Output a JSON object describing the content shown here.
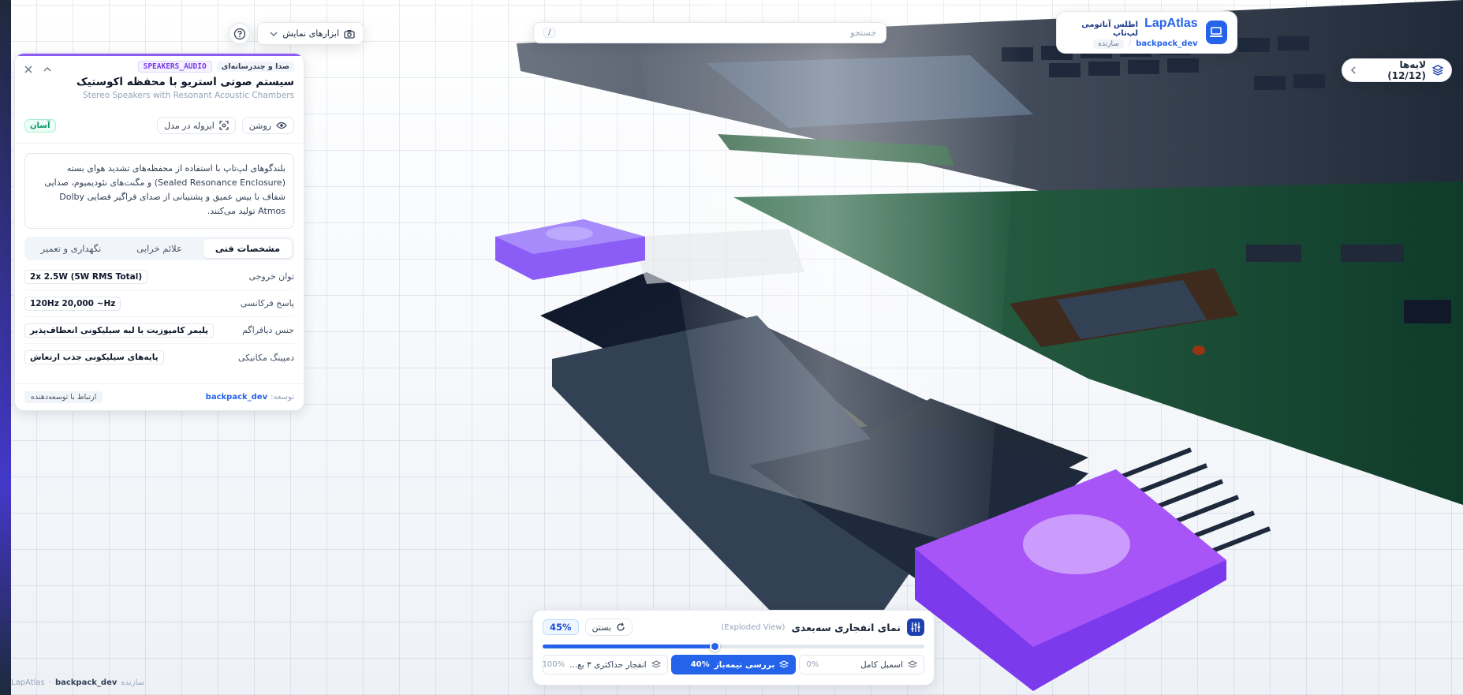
{
  "brand": {
    "name_a": "Lap",
    "name_b": "Atlas",
    "subtitle": "اطلس آناتومی لپ‌تاپ",
    "developer": "backpack_dev",
    "role": "سازنده"
  },
  "layers": {
    "label": "لایه‌ها (12/12)"
  },
  "search": {
    "placeholder": "جستجو",
    "shortcut": "/"
  },
  "toolbar": {
    "view_tools_label": "ابزارهای نمایش"
  },
  "detail": {
    "category_tag": "صدا و چندرسانه‌ای",
    "code_tag": "SPEAKERS_AUDIO",
    "title": "سیستم صوتی استریو با محفظه اکوستیک",
    "title_en": "Stereo Speakers with Resonant Acoustic Chambers",
    "actions": {
      "light_label": "روشن",
      "isolate_label": "ایزوله در مدل"
    },
    "difficulty": "آسان",
    "description": "بلندگوهای لپ‌تاپ با استفاده از محفظه‌های تشدید هوای بسته (Sealed Resonance Enclosure) و مگنت‌های نئودیمیوم، صدایی شفاف با بیس عمیق و پشتیبانی از صدای فراگیر فضایی Dolby Atmos تولید می‌کنند.",
    "tabs": [
      "مشخصات فنی",
      "علائم خرابی",
      "نگهداری و تعمیر"
    ],
    "specs": [
      {
        "label": "توان خروجی",
        "value": "2x 2.5W (5W RMS Total)"
      },
      {
        "label": "پاسخ فرکانسی",
        "value": "120Hz 20,000 ~Hz"
      },
      {
        "label": "جنس دیافراگم",
        "value": "پلیمر کامپوزیت با لبه سیلیکونی انعطاف‌پذیر"
      },
      {
        "label": "دمپینگ مکانیکی",
        "value": "پایه‌های سیلیکونی جذب ارتعاش"
      }
    ],
    "footer": {
      "by_label": "توسعه:",
      "developer": "backpack_dev",
      "contact_label": "ارتباط با توسعه‌دهنده"
    }
  },
  "exploded": {
    "title": "نمای انفجاری سه‌بعدی",
    "subtitle": "(Exploded View)",
    "close_label": "بستن",
    "value_label": "45%",
    "progress": 0.45,
    "presets": [
      {
        "label": "اسمبل کامل",
        "value": "0%"
      },
      {
        "label": "بررسی نیمه‌باز",
        "value": "40%"
      },
      {
        "label": "انفجار حداکثری ۳ بع...",
        "value": "100%"
      }
    ]
  },
  "footer": {
    "role": "سازنده",
    "developer": "backpack_dev",
    "app": "LapAtlas"
  },
  "colors": {
    "accent": "#2563eb",
    "component_highlight": "#a855f7",
    "difficulty_easy": "#059669"
  },
  "icons": [
    "laptop-icon",
    "layers-icon",
    "chevron-left-icon",
    "camera-icon",
    "chevron-down-icon",
    "help-icon",
    "close-icon",
    "chevron-up-icon",
    "eye-icon",
    "focus-icon",
    "refresh-icon",
    "sliders-icon",
    "stack-icon"
  ]
}
